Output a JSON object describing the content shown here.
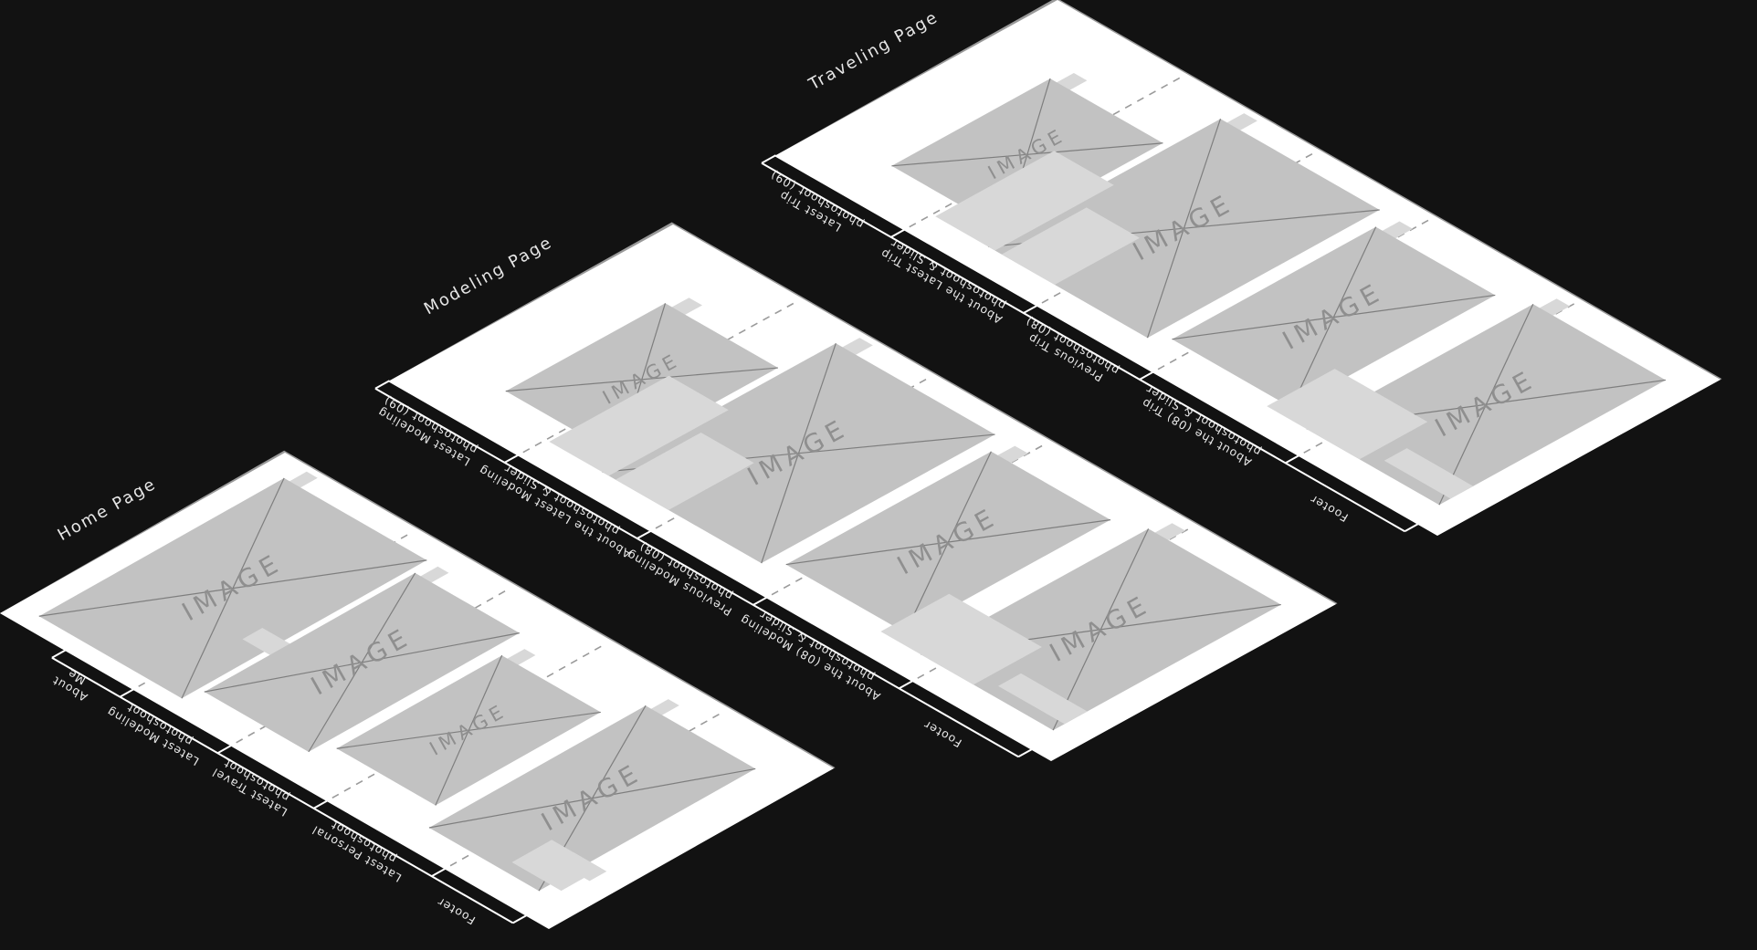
{
  "colors": {
    "background": "#121212",
    "page": "#ffffff",
    "placeholder": "#c2c2c2",
    "bar": "#d8d8d8",
    "divider": "#9a9a9a",
    "cross": "#7e7e7e",
    "annotation": "#ffffff"
  },
  "placeholder_text": "IMAGE",
  "pages": [
    {
      "title": "Home Page",
      "sections": [
        {
          "lines": [
            "About",
            "Me"
          ]
        },
        {
          "lines": [
            "Latest Modeling",
            "photoshoot"
          ]
        },
        {
          "lines": [
            "Latest Travel",
            "photoshoot"
          ]
        },
        {
          "lines": [
            "Latest Personal",
            "photoshoot"
          ]
        },
        {
          "lines": [
            "Footer"
          ]
        }
      ]
    },
    {
      "title": "Modeling Page",
      "sections": [
        {
          "lines": [
            "Latest Modeling",
            "photoshoot (09)"
          ]
        },
        {
          "lines": [
            "About the Latest Modeling",
            "photoshoot & Slider"
          ]
        },
        {
          "lines": [
            "Previous Modeling",
            "photoshoot (08)"
          ]
        },
        {
          "lines": [
            "About the (08) Modeling",
            "photoshoot & Slider"
          ]
        },
        {
          "lines": [
            "Footer"
          ]
        }
      ]
    },
    {
      "title": "Traveling Page",
      "sections": [
        {
          "lines": [
            "Latest Trip",
            "photoshoot (09)"
          ]
        },
        {
          "lines": [
            "About the Latest Trip",
            "photoshoot & Slider"
          ]
        },
        {
          "lines": [
            "Previous Trip",
            "photoshoot (08)"
          ]
        },
        {
          "lines": [
            "About the (08) Trip",
            "photoshoot & Slider"
          ]
        },
        {
          "lines": [
            "Footer"
          ]
        }
      ]
    }
  ]
}
